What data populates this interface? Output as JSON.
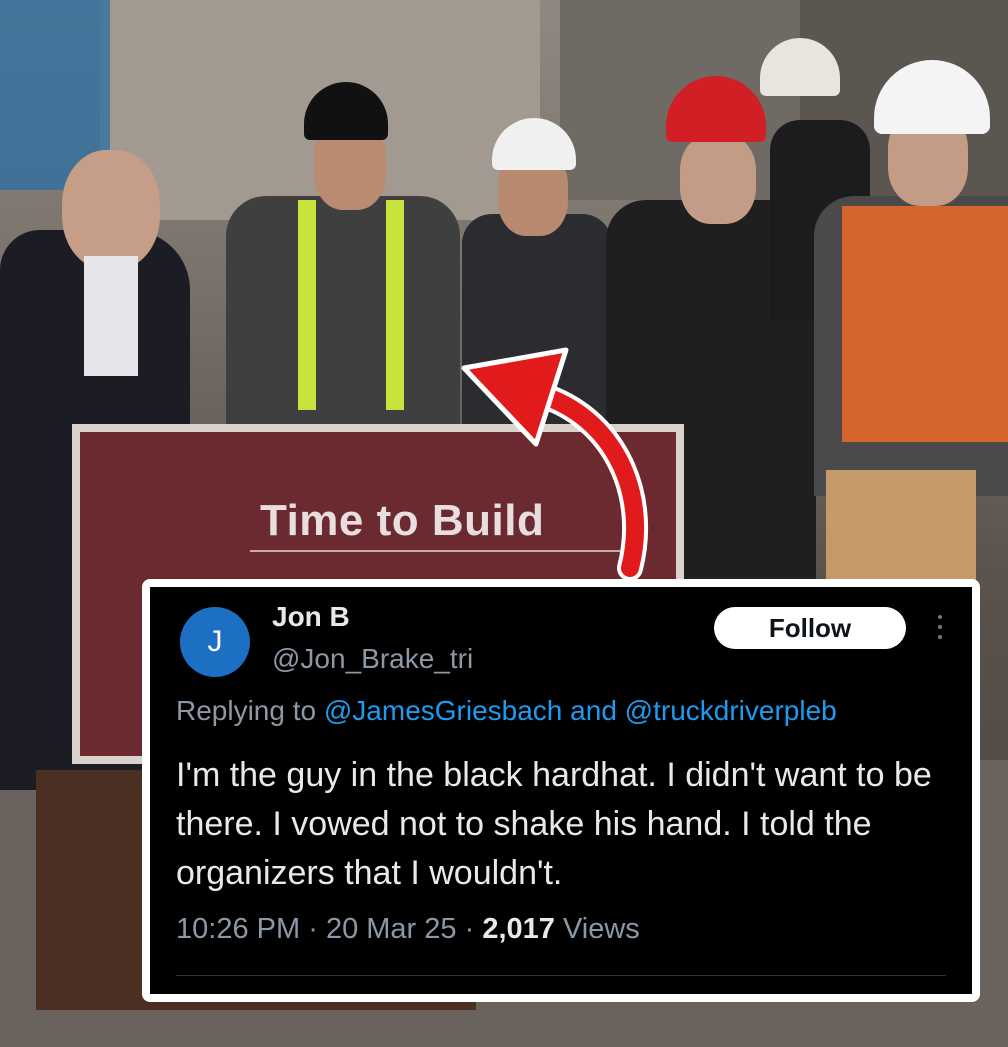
{
  "scene": {
    "podium_sign_title": "Time to Build"
  },
  "tweet": {
    "avatar_initial": "J",
    "display_name": "Jon B",
    "handle": "@Jon_Brake_tri",
    "follow_label": "Follow",
    "replying_prefix": "Replying to",
    "mention_1": "@JamesGriesbach",
    "mention_joiner": "and",
    "mention_2": "@truckdriverpleb",
    "text": "I'm the guy in the black hardhat. I didn't want to be there. I vowed not to shake his hand. I told the organizers that I wouldn't.",
    "time": "10:26 PM",
    "date": "20 Mar 25",
    "separator": "·",
    "views_count": "2,017",
    "views_label": "Views"
  },
  "colors": {
    "card_bg": "#000000",
    "link_blue": "#1d9bf0",
    "avatar_blue": "#1d6fc4",
    "arrow_red": "#e11b1b",
    "podium_maroon": "#6b2a2f"
  },
  "icons": [
    "more-options-icon",
    "red-curved-arrow-icon"
  ]
}
